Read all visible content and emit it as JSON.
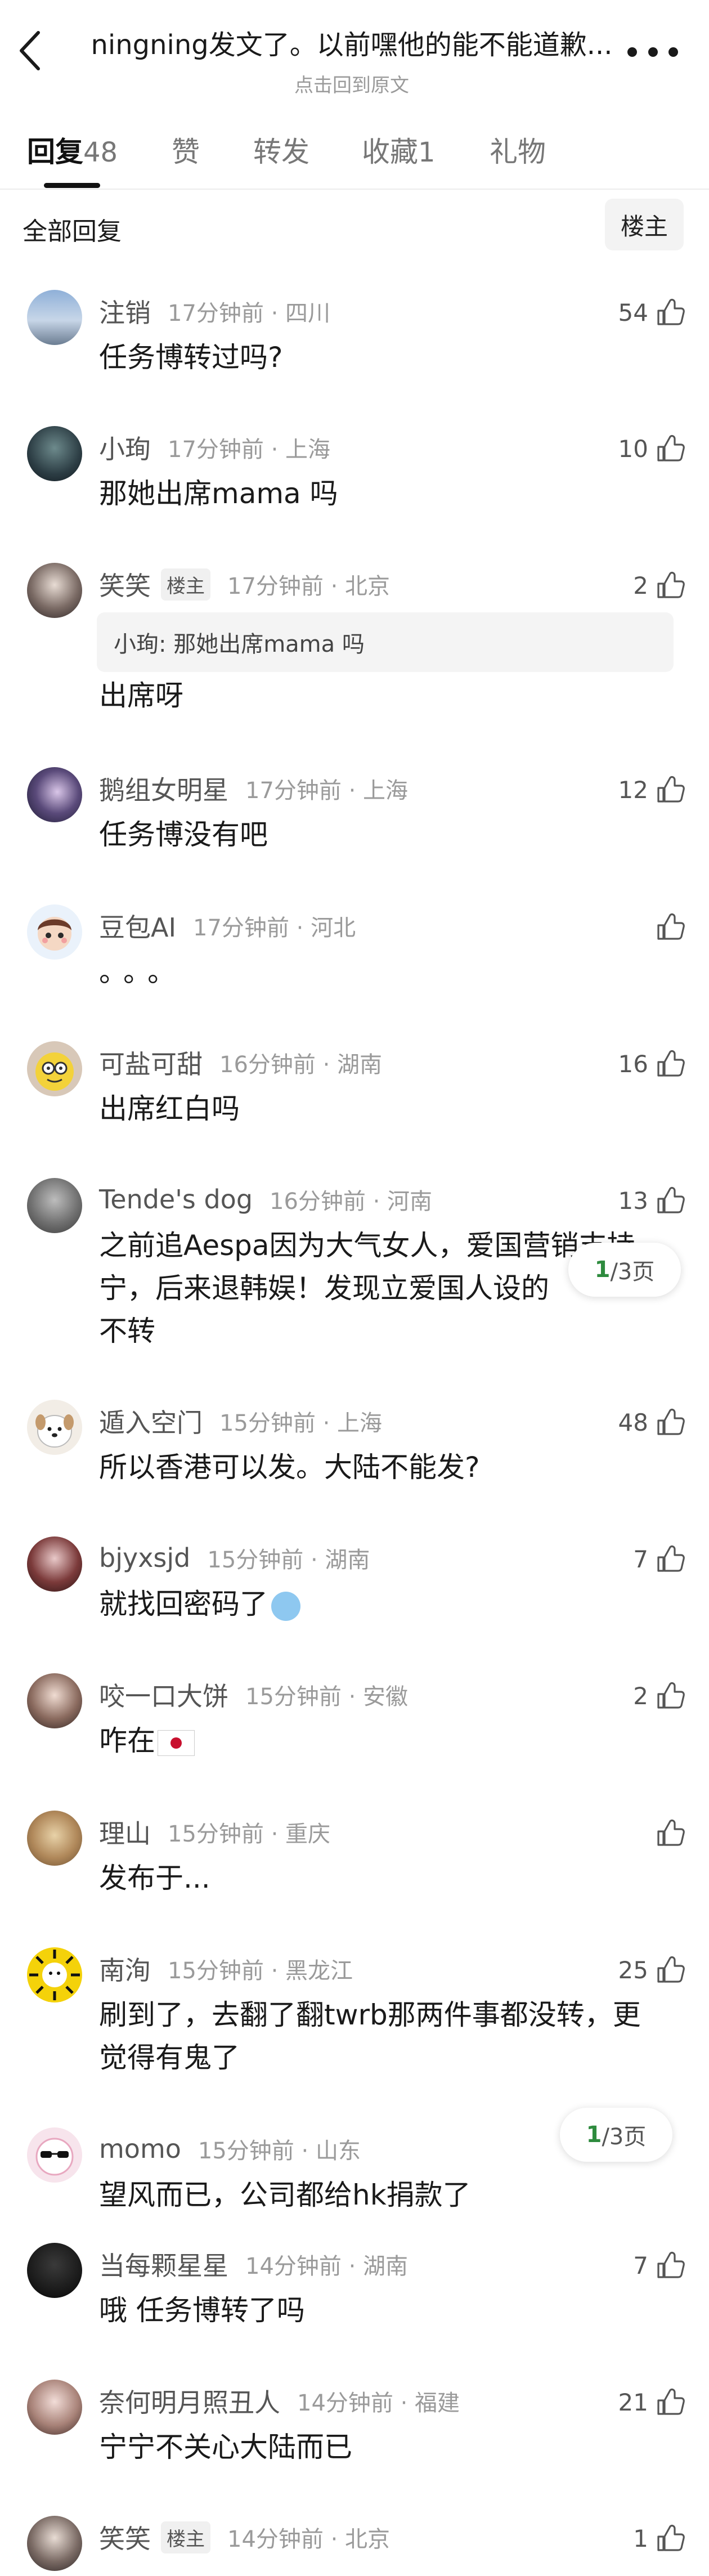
{
  "header": {
    "title": "ningning发文了。以前嘿他的能不能道歉...",
    "subtitle": "点击回到原文"
  },
  "tabs": [
    {
      "label": "回复",
      "count": "48"
    },
    {
      "label": "赞",
      "count": ""
    },
    {
      "label": "转发",
      "count": ""
    },
    {
      "label": "收藏",
      "count": "1"
    },
    {
      "label": "礼物",
      "count": ""
    }
  ],
  "filter": {
    "label": "全部回复",
    "button": "楼主"
  },
  "pager": {
    "current": "1",
    "total": "/3页"
  },
  "comments": [
    {
      "name": "注销",
      "time": "17分钟前 · 四川",
      "likes": "54",
      "text": "任务博转过吗?"
    },
    {
      "name": "小珣",
      "time": "17分钟前 · 上海",
      "likes": "10",
      "text": "那她出席mama 吗"
    },
    {
      "name": "笑笑",
      "badge": "楼主",
      "time": "17分钟前 · 北京",
      "likes": "2",
      "quote": "小珣: 那她出席mama 吗",
      "text": "出席呀"
    },
    {
      "name": "鹅组女明星",
      "time": "17分钟前 · 上海",
      "likes": "12",
      "text": "任务博没有吧"
    },
    {
      "name": "豆包AI",
      "time": "17分钟前 · 河北",
      "likes": "",
      "text": "。。。"
    },
    {
      "name": "可盐可甜",
      "time": "16分钟前 · 湖南",
      "likes": "16",
      "text": "出席红白吗"
    },
    {
      "name": "Tende's dog",
      "time": "16分钟前 · 河南",
      "likes": "13",
      "text_lines": [
        "之前追Aespa因为大气女人，爱国营销支持",
        "宁，后来退韩娱！发现立爱国人设的",
        "不转"
      ]
    },
    {
      "name": "遁入空门",
      "time": "15分钟前 · 上海",
      "likes": "48",
      "text": "所以香港可以发。大陆不能发?"
    },
    {
      "name": "bjyxsjd",
      "time": "15分钟前 · 湖南",
      "likes": "7",
      "text": "就找回密码了"
    },
    {
      "name": "咬一口大饼",
      "time": "15分钟前 · 安徽",
      "likes": "2",
      "text": "咋在"
    },
    {
      "name": "理山",
      "time": "15分钟前 · 重庆",
      "likes": "",
      "text": "发布于..."
    },
    {
      "name": "南洵",
      "time": "15分钟前 · 黑龙江",
      "likes": "25",
      "text_lines": [
        "刷到了，去翻了翻twrb那两件事都没转，更",
        "觉得有鬼了"
      ]
    },
    {
      "name": "momo",
      "time": "15分钟前 · 山东",
      "likes": "",
      "text": "望风而已，公司都给hk捐款了"
    },
    {
      "name": "当每颗星星",
      "time": "14分钟前 · 湖南",
      "likes": "7",
      "text": "哦 任务博转了吗"
    },
    {
      "name": "奈何明月照丑人",
      "time": "14分钟前 · 福建",
      "likes": "21",
      "text": "宁宁不关心大陆而已"
    },
    {
      "name": "笑笑",
      "badge": "楼主",
      "time": "14分钟前 · 北京",
      "likes": "1",
      "text": ""
    }
  ]
}
